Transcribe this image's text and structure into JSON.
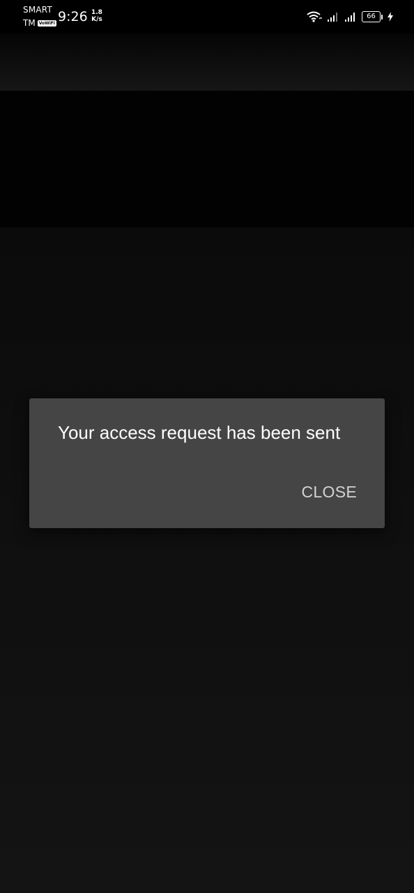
{
  "status_bar": {
    "carrier_line1": "SMART",
    "carrier_line2": "TM",
    "vowifi_label": "VoWiFi",
    "time": "9:26",
    "net_speed_value": "1.8",
    "net_speed_unit": "K/s",
    "battery_level": "66",
    "icons": [
      "wifi-icon",
      "signal-icon",
      "signal-icon",
      "battery-icon",
      "charging-icon"
    ]
  },
  "dialog": {
    "message": "Your access request has been sent",
    "close_label": "CLOSE"
  },
  "colors": {
    "background": "#000000",
    "dialog_background": "#454545",
    "dialog_text": "#ffffff",
    "button_text": "#d3d3d3"
  }
}
